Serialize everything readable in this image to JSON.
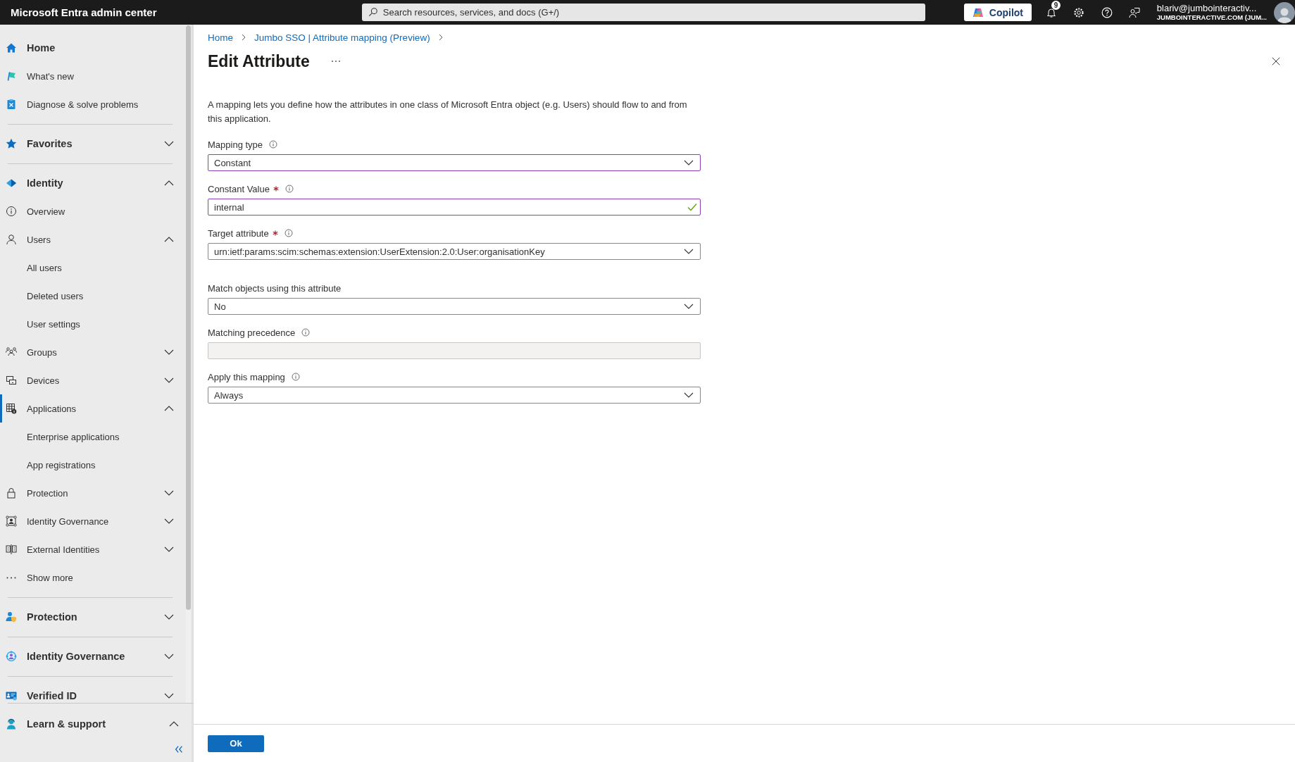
{
  "topbar": {
    "title": "Microsoft Entra admin center",
    "search": {
      "placeholder": "Search resources, services, and docs (G+/)"
    },
    "copilot": "Copilot",
    "notifications": {
      "count": "9"
    },
    "account": {
      "email": "blariv@jumbointeractiv...",
      "tenant": "JUMBOINTERACTIVE.COM (JUM..."
    }
  },
  "sidebar": {
    "items": [
      {
        "kind": "section",
        "label": "Home",
        "selected": false
      },
      {
        "kind": "item",
        "label": "What's new",
        "selected": false
      },
      {
        "kind": "item",
        "label": "Diagnose & solve problems",
        "selected": false
      },
      {
        "kind": "divider"
      },
      {
        "kind": "section",
        "label": "Favorites",
        "expanded": false,
        "selected": false
      },
      {
        "kind": "divider"
      },
      {
        "kind": "section",
        "label": "Identity",
        "expanded": true,
        "selected": false
      },
      {
        "kind": "item",
        "label": "Overview",
        "selected": false
      },
      {
        "kind": "item",
        "label": "Users",
        "expanded": true,
        "selected": false
      },
      {
        "kind": "sub",
        "label": "All users",
        "selected": false
      },
      {
        "kind": "sub",
        "label": "Deleted users",
        "selected": false
      },
      {
        "kind": "sub",
        "label": "User settings",
        "selected": false
      },
      {
        "kind": "item",
        "label": "Groups",
        "expanded": false,
        "selected": false
      },
      {
        "kind": "item",
        "label": "Devices",
        "expanded": false,
        "selected": false
      },
      {
        "kind": "item",
        "label": "Applications",
        "expanded": true,
        "selected": true
      },
      {
        "kind": "sub",
        "label": "Enterprise applications",
        "selected": false
      },
      {
        "kind": "sub",
        "label": "App registrations",
        "selected": false
      },
      {
        "kind": "item",
        "label": "Protection",
        "expanded": false,
        "selected": false
      },
      {
        "kind": "item",
        "label": "Identity Governance",
        "expanded": false,
        "selected": false
      },
      {
        "kind": "item",
        "label": "External Identities",
        "expanded": false,
        "selected": false
      },
      {
        "kind": "item",
        "label": "Show more",
        "selected": false
      },
      {
        "kind": "divider"
      },
      {
        "kind": "section",
        "label": "Protection",
        "expanded": false,
        "selected": false
      },
      {
        "kind": "divider"
      },
      {
        "kind": "section",
        "label": "Identity Governance",
        "expanded": false,
        "selected": false
      },
      {
        "kind": "divider"
      },
      {
        "kind": "section",
        "label": "Verified ID",
        "expanded": false,
        "selected": false
      }
    ],
    "bottom": {
      "label": "Learn & support",
      "expanded": true
    }
  },
  "panel": {
    "breadcrumb": [
      "Home",
      "Jumbo SSO | Attribute mapping (Preview)"
    ],
    "title": "Edit Attribute",
    "description": "A mapping lets you define how the attributes in one class of Microsoft Entra object (e.g. Users) should flow to and from this application.",
    "fields": [
      {
        "kind": "dropdown",
        "label": "Mapping type",
        "required": false,
        "info": true,
        "value": "Constant",
        "focused": true,
        "valid": false,
        "disabled": false
      },
      {
        "kind": "text",
        "label": "Constant Value",
        "required": true,
        "info": true,
        "value": "internal",
        "focused": true,
        "valid": true,
        "disabled": false
      },
      {
        "kind": "dropdown",
        "label": "Target attribute",
        "required": true,
        "info": true,
        "value": "urn:ietf:params:scim:schemas:extension:UserExtension:2.0:User:organisationKey",
        "focused": false,
        "valid": false,
        "disabled": false
      },
      {
        "kind": "dropdown",
        "label": "Match objects using this attribute",
        "required": false,
        "info": false,
        "value": "No",
        "focused": false,
        "valid": false,
        "disabled": false
      },
      {
        "kind": "text",
        "label": "Matching precedence",
        "required": false,
        "info": true,
        "focused": false,
        "valid": false,
        "disabled": true
      },
      {
        "kind": "dropdown",
        "label": "Apply this mapping",
        "required": false,
        "info": true,
        "value": "Always",
        "focused": false,
        "valid": false,
        "disabled": false
      }
    ],
    "ok_button": "Ok"
  }
}
